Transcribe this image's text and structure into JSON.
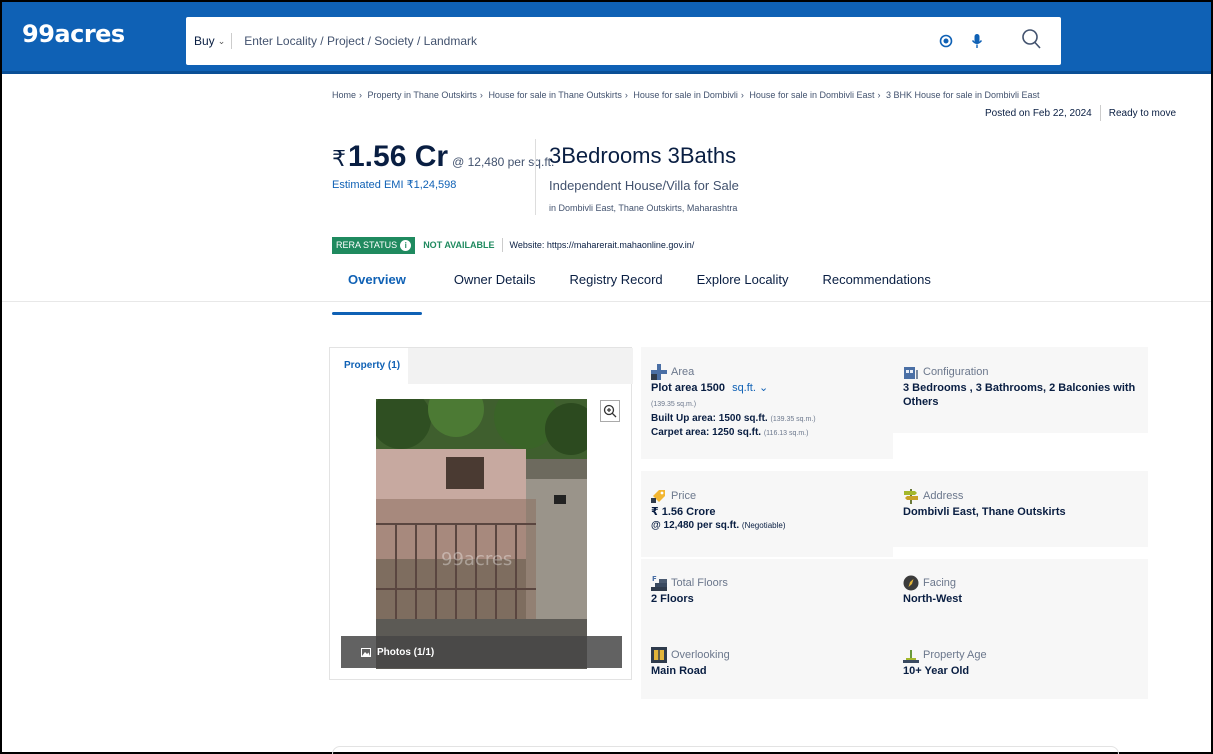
{
  "header": {
    "logo": "99acres",
    "buy_label": "Buy",
    "search_placeholder": "Enter Locality / Project / Society / Landmark"
  },
  "breadcrumbs": [
    "Home",
    "Property in Thane Outskirts",
    "House for sale in Thane Outskirts",
    "House for sale in Dombivli",
    "House for sale in Dombivli East",
    "3 BHK House for sale in Dombivli East"
  ],
  "meta": {
    "posted": "Posted on Feb 22, 2024",
    "status": "Ready to move"
  },
  "listing": {
    "rupee": "₹",
    "price": "1.56 Cr",
    "per_sqft": "@ 12,480 per sq.ft.",
    "emi": "Estimated EMI ₹1,24,598",
    "title": "3Bedrooms 3Baths",
    "type": "Independent House/Villa for Sale",
    "location": "in Dombivli East, Thane Outskirts, Maharashtra"
  },
  "rera": {
    "label": "RERA STATUS",
    "status": "NOT AVAILABLE",
    "website": "Website: https://maharerait.mahaonline.gov.in/"
  },
  "tabs": [
    "Overview",
    "Owner Details",
    "Registry Record",
    "Explore Locality",
    "Recommendations"
  ],
  "photo": {
    "tab_label": "Property (1)",
    "photos_label": "Photos (1/1)",
    "watermark": "99acres"
  },
  "facts": {
    "area": {
      "label": "Area",
      "plot": "Plot area 1500",
      "unit": "sq.ft.",
      "plot_sqm": "(139.35 sq.m.)",
      "built_up": "Built Up area: 1500 sq.ft.",
      "built_up_sqm": "(139.35 sq.m.)",
      "carpet": "Carpet area: 1250 sq.ft.",
      "carpet_sqm": "(116.13 sq.m.)"
    },
    "configuration": {
      "label": "Configuration",
      "value": "3 Bedrooms , 3 Bathrooms, 2 Balconies with Others"
    },
    "price": {
      "label": "Price",
      "value": "₹ 1.56 Crore",
      "per_sqft": "@ 12,480 per sq.ft.",
      "negotiable": "(Negotiable)"
    },
    "address": {
      "label": "Address",
      "value": "Dombivli East, Thane Outskirts"
    },
    "floors": {
      "label": "Total Floors",
      "value": "2 Floors"
    },
    "facing": {
      "label": "Facing",
      "value": "North-West"
    },
    "overlooking": {
      "label": "Overlooking",
      "value": "Main Road"
    },
    "age": {
      "label": "Property Age",
      "value": "10+ Year Old"
    }
  }
}
